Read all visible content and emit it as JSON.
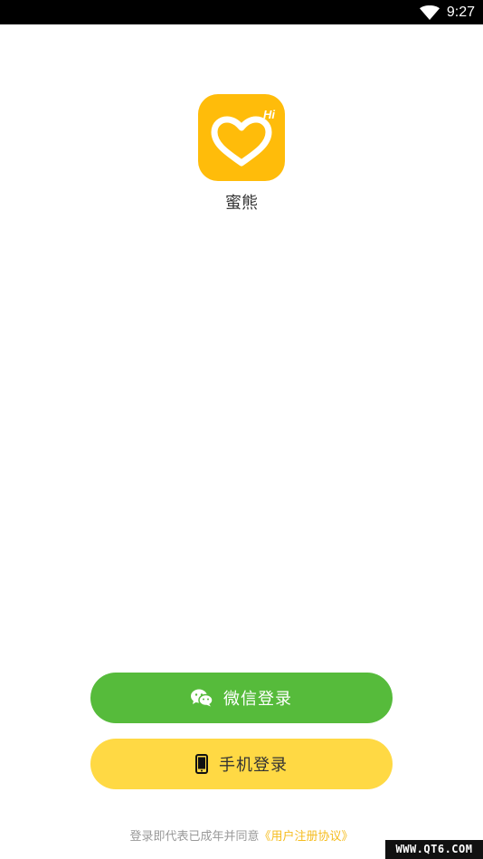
{
  "status_bar": {
    "time": "9:27",
    "wifi_icon": "wifi-icon"
  },
  "app": {
    "name": "蜜熊",
    "logo_text": "Hi",
    "logo_color": "#FFBC0A"
  },
  "buttons": {
    "wechat_label": "微信登录",
    "wechat_icon": "wechat-icon",
    "wechat_color": "#56BB3B",
    "phone_label": "手机登录",
    "phone_icon": "phone-icon",
    "phone_color": "#FFD944"
  },
  "agreement": {
    "text": "登录即代表已成年并同意",
    "link": "《用户注册协议》"
  },
  "watermark": {
    "text": "WWW.QT6.COM"
  }
}
